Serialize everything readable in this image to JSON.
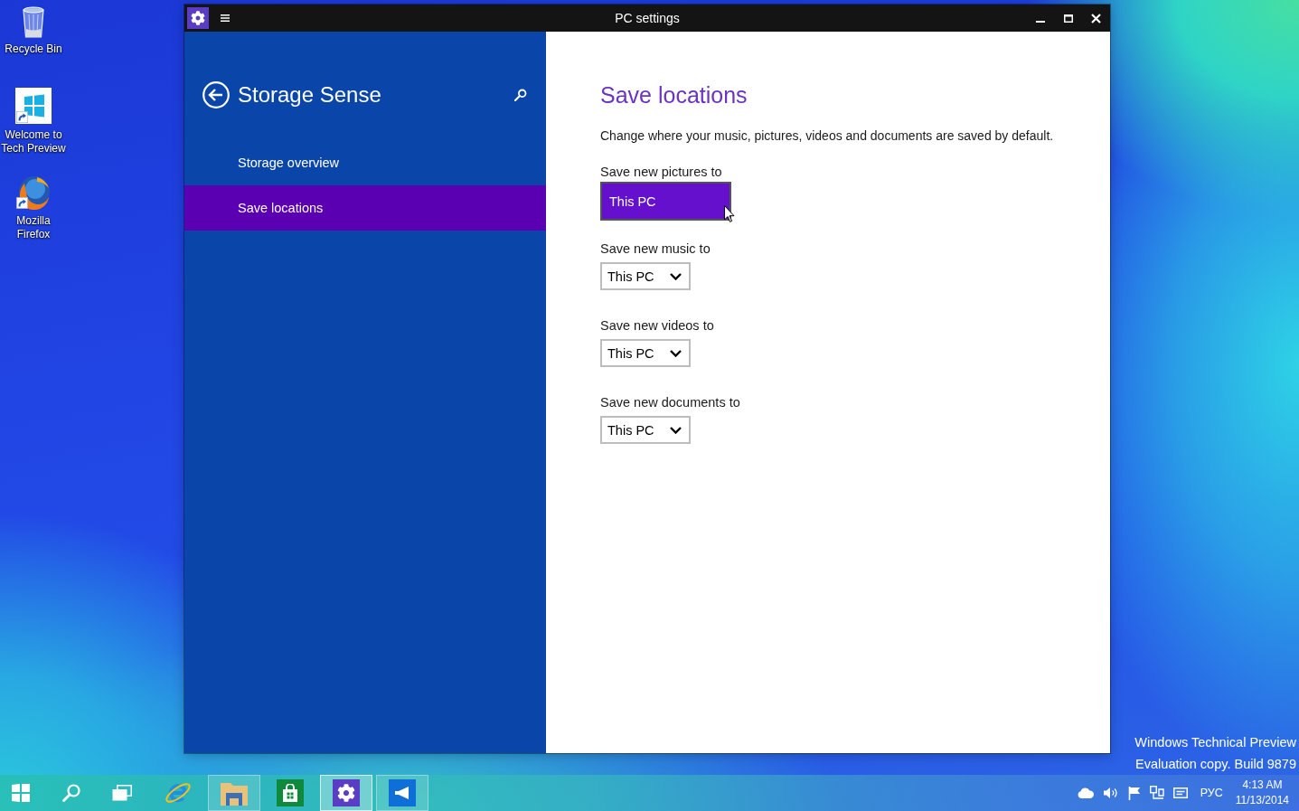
{
  "desktop": {
    "icons": [
      {
        "kind": "recycle_bin",
        "label": "Recycle Bin",
        "shortcut": false
      },
      {
        "kind": "tile",
        "label": "Welcome to Tech Preview",
        "shortcut": true
      },
      {
        "kind": "globe",
        "label": "Mozilla Firefox",
        "shortcut": true
      }
    ],
    "build_info": [
      "Windows Technical Preview",
      "Evaluation copy. Build 9879"
    ]
  },
  "window": {
    "title": "PC settings"
  },
  "sidebar": {
    "title": "Storage Sense",
    "items": [
      {
        "label": "Storage overview",
        "selected": false
      },
      {
        "label": "Save locations",
        "selected": true
      }
    ]
  },
  "content": {
    "title": "Save locations",
    "description": "Change where your music, pictures, videos and documents are saved by default.",
    "settings": [
      {
        "label": "Save new pictures to",
        "value": "This PC",
        "expanded": true
      },
      {
        "label": "Save new music to",
        "value": "This PC",
        "expanded": false
      },
      {
        "label": "Save new videos to",
        "value": "This PC",
        "expanded": false
      },
      {
        "label": "Save new documents to",
        "value": "This PC",
        "expanded": false
      }
    ]
  },
  "taskbar": {
    "apps": [
      {
        "kind": "browser",
        "running": false,
        "selected": false
      },
      {
        "kind": "files",
        "running": true,
        "selected": false
      },
      {
        "kind": "store",
        "running": false,
        "selected": false
      },
      {
        "kind": "settings",
        "running": true,
        "selected": true
      },
      {
        "kind": "feedback",
        "running": true,
        "selected": false
      }
    ],
    "language": "РУС",
    "time": "4:13 AM",
    "date": "11/13/2014"
  }
}
